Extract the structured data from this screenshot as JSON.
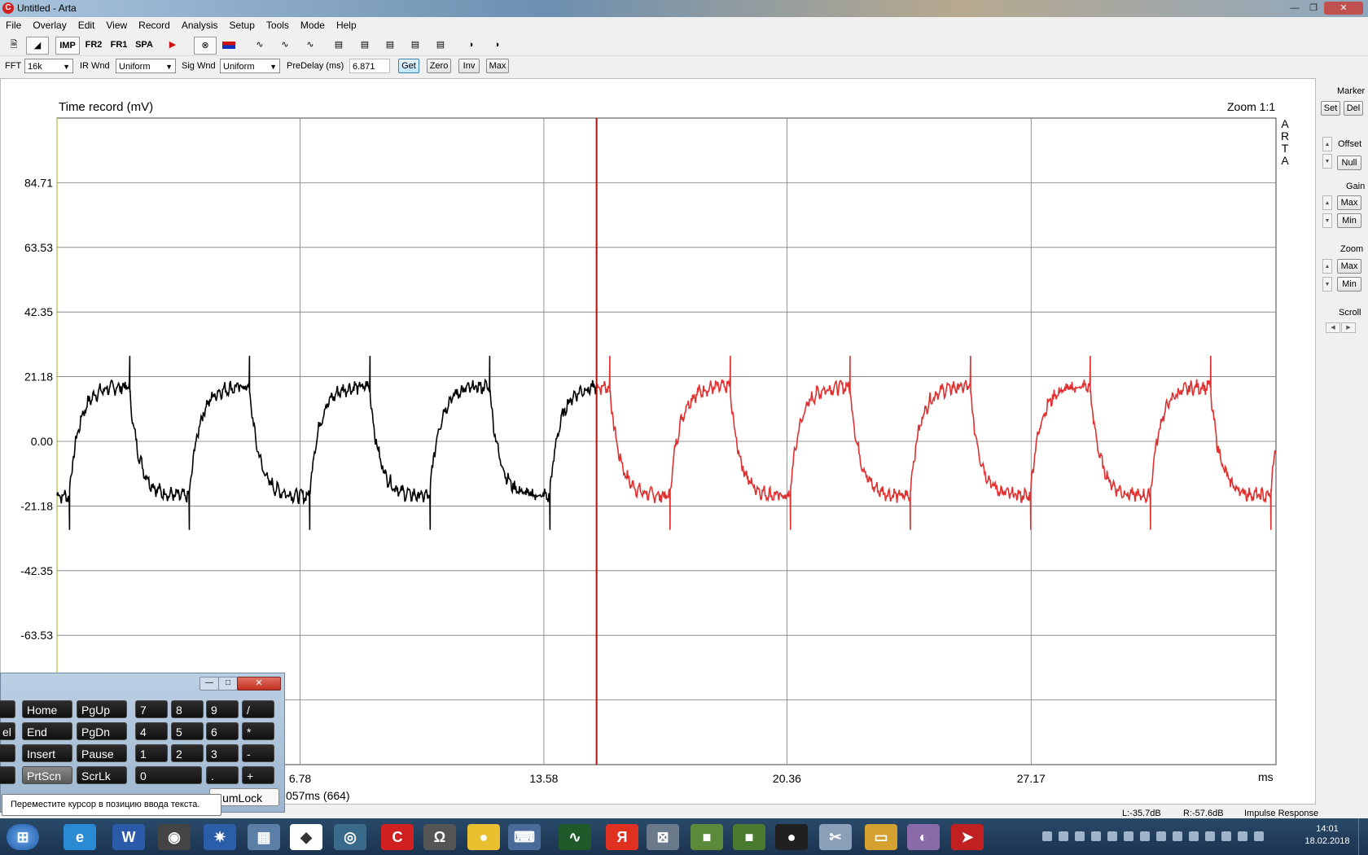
{
  "window": {
    "title": "Untitled - Arta",
    "app_icon_letter": "C"
  },
  "menu": [
    "File",
    "Overlay",
    "Edit",
    "View",
    "Record",
    "Analysis",
    "Setup",
    "Tools",
    "Mode",
    "Help"
  ],
  "toolbar": {
    "mode_labels": [
      "IMP",
      "FR2",
      "FR1",
      "SPA"
    ]
  },
  "controls": {
    "fft_label": "FFT",
    "fft_value": "16k",
    "ir_wnd_label": "IR Wnd",
    "ir_wnd_value": "Uniform",
    "sig_wnd_label": "Sig Wnd",
    "sig_wnd_value": "Uniform",
    "predelay_label": "PreDelay (ms)",
    "predelay_value": "6.871",
    "get": "Get",
    "zero": "Zero",
    "inv": "Inv",
    "max": "Max"
  },
  "chart": {
    "title": "Time record (mV)",
    "zoom": "Zoom 1:1",
    "arta_letters": [
      "A",
      "R",
      "T",
      "A"
    ],
    "x_unit": "ms",
    "cursor_readout": "057ms (664)"
  },
  "chart_data": {
    "type": "line",
    "title": "Time record (mV)",
    "ylabel": "mV",
    "xlabel": "ms",
    "y_ticks": [
      84.71,
      63.53,
      42.35,
      21.18,
      0.0,
      -21.18,
      -42.35,
      -63.53
    ],
    "y_tick_labels": [
      "84.71",
      "63.53",
      "42.35",
      "21.18",
      "0.00",
      "-21.18",
      "-42.35",
      "-63.53"
    ],
    "x_tick_labels": [
      "6.78",
      "13.58",
      "20.36",
      "27.17"
    ],
    "x_ticks": [
      6.78,
      13.58,
      20.36,
      27.17
    ],
    "ylim": [
      -105.88,
      105.88
    ],
    "xlim": [
      0,
      34.0
    ],
    "cursor_x": 15.05,
    "grid": true,
    "series": [
      {
        "color": "#000000",
        "shape": "square-wave-with-spikes",
        "period_ms": 3.35,
        "amplitude_mV": 18,
        "range_ms": [
          0,
          15.05
        ]
      },
      {
        "color": "#e03030",
        "shape": "square-wave-with-spikes",
        "period_ms": 3.35,
        "amplitude_mV": 18,
        "range_ms": [
          15.05,
          34.0
        ]
      }
    ]
  },
  "right_panel": {
    "marker": "Marker",
    "set": "Set",
    "del": "Del",
    "offset": "Offset",
    "null": "Null",
    "gain": "Gain",
    "gain_max": "Max",
    "gain_min": "Min",
    "zoom": "Zoom",
    "zoom_max": "Max",
    "zoom_min": "Min",
    "scroll": "Scroll"
  },
  "status": {
    "left_db": "L:-35.7dB",
    "right_db": "R:-57.6dB",
    "mode": "Impulse Response"
  },
  "keyboard": {
    "rows": [
      [
        "Home",
        "PgUp",
        "7",
        "8",
        "9",
        "/"
      ],
      [
        "End",
        "PgDn",
        "4",
        "5",
        "6",
        "*"
      ],
      [
        "Insert",
        "Pause",
        "1",
        "2",
        "3",
        "-"
      ],
      [
        "PrtScn",
        "ScrLk",
        "0",
        ".",
        "+"
      ]
    ],
    "left_partial": [
      "el"
    ],
    "numlock": "NumLock",
    "tooltip": "Переместите курсор в позицию ввода текста."
  },
  "taskbar": {
    "time": "14:01",
    "date": "18.02.2018",
    "icons": [
      "start-icon",
      "ie-icon",
      "word-icon",
      "camera-icon",
      "compass-icon",
      "calculator-icon",
      "fox-icon",
      "radar-icon",
      "arta-icon",
      "omega-icon",
      "chrome-icon",
      "keyboard-icon",
      "scope-icon",
      "yandex-icon",
      "plot-icon",
      "minecraft-icon",
      "minecraft2-icon",
      "record-icon",
      "scissors-icon",
      "folder-icon",
      "paint-icon",
      "arrow-icon"
    ],
    "icon_glyphs": [
      "⊞",
      "e",
      "W",
      "◉",
      "✷",
      "▦",
      "◆",
      "◎",
      "C",
      "Ω",
      "●",
      "⌨",
      "∿",
      "Я",
      "⊠",
      "■",
      "■",
      "●",
      "✂",
      "▭",
      "◐",
      "➤"
    ],
    "icon_colors": [
      "#3a78c8",
      "#2a8ad4",
      "#2b5aa8",
      "#444444",
      "#2a5ea8",
      "#5c7fa8",
      "#ffffff",
      "#3a6a8a",
      "#d02020",
      "#555555",
      "#e8c030",
      "#4a6a9a",
      "#1e5a2a",
      "#e03020",
      "#6a7a8a",
      "#5a8a3a",
      "#4a7a30",
      "#202020",
      "#8aa0b8",
      "#d4a030",
      "#8a6aa8",
      "#c02020"
    ]
  }
}
